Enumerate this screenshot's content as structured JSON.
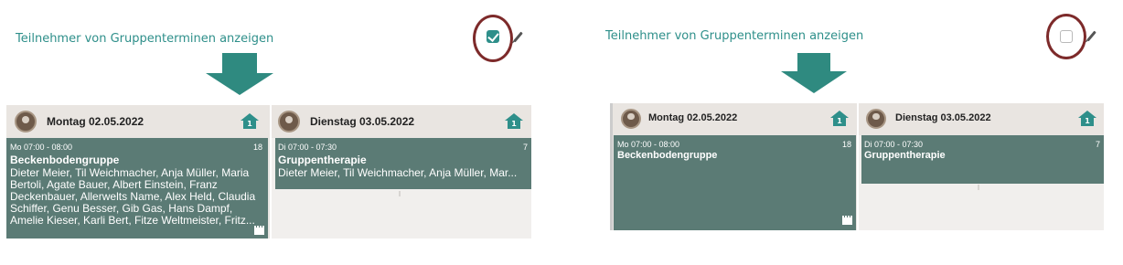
{
  "toggle": {
    "label": "Teilnehmer von Gruppenterminen anzeigen"
  },
  "left": {
    "checked": true,
    "days": [
      {
        "title": "Montag 02.05.2022",
        "home_badge": "1",
        "appt": {
          "time": "Mo 07:00 - 08:00",
          "count": "18",
          "title": "Beckenbodengruppe",
          "participants": "Dieter Meier, Til Weichmacher, Anja Müller, Maria Bertoli, Agate Bauer, Albert Einstein, Franz Deckenbauer, Allerwelts Name, Alex Held, Claudia Schiffer, Genu Besser, Gib Gas, Hans Dampf, Amelie Kieser, Karli Bert, Fitze Weltmeister, Fritz..."
        }
      },
      {
        "title": "Dienstag 03.05.2022",
        "home_badge": "1",
        "appt": {
          "time": "Di 07:00 - 07:30",
          "count": "7",
          "title": "Gruppentherapie",
          "participants": "Dieter Meier, Til Weichmacher, Anja Müller, Mar..."
        }
      }
    ]
  },
  "right": {
    "checked": false,
    "days": [
      {
        "title": "Montag 02.05.2022",
        "home_badge": "1",
        "appt": {
          "time": "Mo 07:00 - 08:00",
          "count": "18",
          "title": "Beckenbodengruppe"
        }
      },
      {
        "title": "Dienstag 03.05.2022",
        "home_badge": "1",
        "appt": {
          "time": "Di 07:00 - 07:30",
          "count": "7",
          "title": "Gruppentherapie"
        }
      }
    ]
  },
  "icons": {
    "checkbox": "checkbox-icon",
    "edit": "pencil-icon",
    "arrow": "arrow-down-icon",
    "home": "home-icon",
    "film": "film-icon",
    "avatar": "avatar-icon"
  },
  "colors": {
    "accent": "#2e8f8a",
    "appointment": "#5b7b75",
    "highlight_ring": "#7d2a2a",
    "header_bg": "#e9e5e1"
  }
}
